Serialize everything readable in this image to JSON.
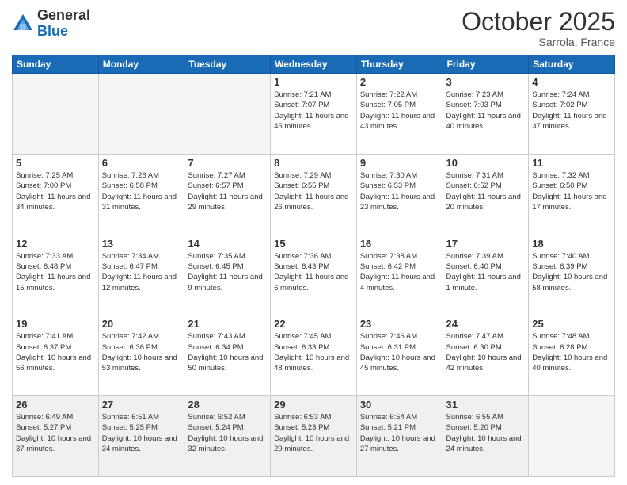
{
  "header": {
    "logo_general": "General",
    "logo_blue": "Blue",
    "month_title": "October 2025",
    "subtitle": "Sarrola, France"
  },
  "days_of_week": [
    "Sunday",
    "Monday",
    "Tuesday",
    "Wednesday",
    "Thursday",
    "Friday",
    "Saturday"
  ],
  "weeks": [
    [
      {
        "day": "",
        "info": ""
      },
      {
        "day": "",
        "info": ""
      },
      {
        "day": "",
        "info": ""
      },
      {
        "day": "1",
        "info": "Sunrise: 7:21 AM\nSunset: 7:07 PM\nDaylight: 11 hours and 45 minutes."
      },
      {
        "day": "2",
        "info": "Sunrise: 7:22 AM\nSunset: 7:05 PM\nDaylight: 11 hours and 43 minutes."
      },
      {
        "day": "3",
        "info": "Sunrise: 7:23 AM\nSunset: 7:03 PM\nDaylight: 11 hours and 40 minutes."
      },
      {
        "day": "4",
        "info": "Sunrise: 7:24 AM\nSunset: 7:02 PM\nDaylight: 11 hours and 37 minutes."
      }
    ],
    [
      {
        "day": "5",
        "info": "Sunrise: 7:25 AM\nSunset: 7:00 PM\nDaylight: 11 hours and 34 minutes."
      },
      {
        "day": "6",
        "info": "Sunrise: 7:26 AM\nSunset: 6:58 PM\nDaylight: 11 hours and 31 minutes."
      },
      {
        "day": "7",
        "info": "Sunrise: 7:27 AM\nSunset: 6:57 PM\nDaylight: 11 hours and 29 minutes."
      },
      {
        "day": "8",
        "info": "Sunrise: 7:29 AM\nSunset: 6:55 PM\nDaylight: 11 hours and 26 minutes."
      },
      {
        "day": "9",
        "info": "Sunrise: 7:30 AM\nSunset: 6:53 PM\nDaylight: 11 hours and 23 minutes."
      },
      {
        "day": "10",
        "info": "Sunrise: 7:31 AM\nSunset: 6:52 PM\nDaylight: 11 hours and 20 minutes."
      },
      {
        "day": "11",
        "info": "Sunrise: 7:32 AM\nSunset: 6:50 PM\nDaylight: 11 hours and 17 minutes."
      }
    ],
    [
      {
        "day": "12",
        "info": "Sunrise: 7:33 AM\nSunset: 6:48 PM\nDaylight: 11 hours and 15 minutes."
      },
      {
        "day": "13",
        "info": "Sunrise: 7:34 AM\nSunset: 6:47 PM\nDaylight: 11 hours and 12 minutes."
      },
      {
        "day": "14",
        "info": "Sunrise: 7:35 AM\nSunset: 6:45 PM\nDaylight: 11 hours and 9 minutes."
      },
      {
        "day": "15",
        "info": "Sunrise: 7:36 AM\nSunset: 6:43 PM\nDaylight: 11 hours and 6 minutes."
      },
      {
        "day": "16",
        "info": "Sunrise: 7:38 AM\nSunset: 6:42 PM\nDaylight: 11 hours and 4 minutes."
      },
      {
        "day": "17",
        "info": "Sunrise: 7:39 AM\nSunset: 6:40 PM\nDaylight: 11 hours and 1 minute."
      },
      {
        "day": "18",
        "info": "Sunrise: 7:40 AM\nSunset: 6:39 PM\nDaylight: 10 hours and 58 minutes."
      }
    ],
    [
      {
        "day": "19",
        "info": "Sunrise: 7:41 AM\nSunset: 6:37 PM\nDaylight: 10 hours and 56 minutes."
      },
      {
        "day": "20",
        "info": "Sunrise: 7:42 AM\nSunset: 6:36 PM\nDaylight: 10 hours and 53 minutes."
      },
      {
        "day": "21",
        "info": "Sunrise: 7:43 AM\nSunset: 6:34 PM\nDaylight: 10 hours and 50 minutes."
      },
      {
        "day": "22",
        "info": "Sunrise: 7:45 AM\nSunset: 6:33 PM\nDaylight: 10 hours and 48 minutes."
      },
      {
        "day": "23",
        "info": "Sunrise: 7:46 AM\nSunset: 6:31 PM\nDaylight: 10 hours and 45 minutes."
      },
      {
        "day": "24",
        "info": "Sunrise: 7:47 AM\nSunset: 6:30 PM\nDaylight: 10 hours and 42 minutes."
      },
      {
        "day": "25",
        "info": "Sunrise: 7:48 AM\nSunset: 6:28 PM\nDaylight: 10 hours and 40 minutes."
      }
    ],
    [
      {
        "day": "26",
        "info": "Sunrise: 6:49 AM\nSunset: 5:27 PM\nDaylight: 10 hours and 37 minutes."
      },
      {
        "day": "27",
        "info": "Sunrise: 6:51 AM\nSunset: 5:25 PM\nDaylight: 10 hours and 34 minutes."
      },
      {
        "day": "28",
        "info": "Sunrise: 6:52 AM\nSunset: 5:24 PM\nDaylight: 10 hours and 32 minutes."
      },
      {
        "day": "29",
        "info": "Sunrise: 6:53 AM\nSunset: 5:23 PM\nDaylight: 10 hours and 29 minutes."
      },
      {
        "day": "30",
        "info": "Sunrise: 6:54 AM\nSunset: 5:21 PM\nDaylight: 10 hours and 27 minutes."
      },
      {
        "day": "31",
        "info": "Sunrise: 6:55 AM\nSunset: 5:20 PM\nDaylight: 10 hours and 24 minutes."
      },
      {
        "day": "",
        "info": ""
      }
    ]
  ]
}
